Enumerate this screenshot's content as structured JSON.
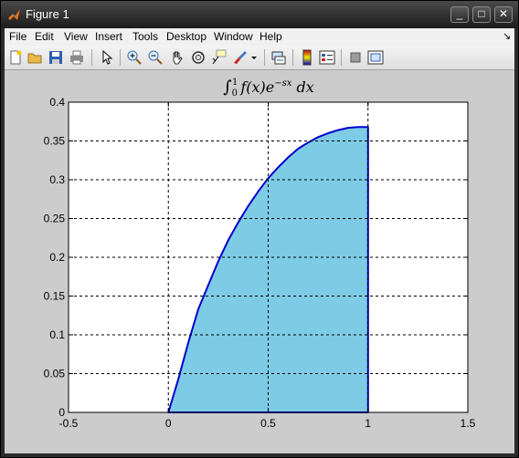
{
  "window": {
    "title": "Figure 1",
    "controls": {
      "minimize": "_",
      "maximize": "□",
      "close": "✕"
    }
  },
  "menubar": {
    "items": [
      "File",
      "Edit",
      "View",
      "Insert",
      "Tools",
      "Desktop",
      "Window",
      "Help"
    ],
    "dock_glyph": "↘"
  },
  "toolbar": {
    "buttons": [
      "new-figure",
      "open-file",
      "save",
      "print",
      "edit-plot-arrow",
      "zoom-in",
      "zoom-out",
      "pan-hand",
      "rotate-3d",
      "data-cursor",
      "brush",
      "brush-dropdown",
      "link-plot",
      "insert-colorbar",
      "insert-legend",
      "hide-plot-tools",
      "show-plot-tools"
    ]
  },
  "colors": {
    "fill": "#7ecbe6",
    "line": "#0000cc",
    "grid": "#000000",
    "background": "#cccccc"
  },
  "chart_data": {
    "type": "area",
    "title": "∫₀¹ f(x)e^(−sx) dx",
    "title_parts": {
      "integral": "∫",
      "lower": "0",
      "upper": "1",
      "fx": "f(x)e",
      "exp": "−sx",
      "dx": " dx"
    },
    "xlabel": "",
    "ylabel": "",
    "xlim": [
      -0.5,
      1.5
    ],
    "ylim": [
      0,
      0.4
    ],
    "xticks": [
      -0.5,
      0,
      0.5,
      1,
      1.5
    ],
    "xtick_labels": [
      "-0.5",
      "0",
      "0.5",
      "1",
      "1.5"
    ],
    "yticks": [
      0,
      0.05,
      0.1,
      0.15,
      0.2,
      0.25,
      0.3,
      0.35,
      0.4
    ],
    "ytick_labels": [
      "0",
      "0.05",
      "0.1",
      "0.15",
      "0.2",
      "0.25",
      "0.3",
      "0.35",
      "0.4"
    ],
    "grid": true,
    "x": [
      0,
      0.05,
      0.1,
      0.15,
      0.2,
      0.25,
      0.3,
      0.35,
      0.4,
      0.45,
      0.5,
      0.55,
      0.6,
      0.65,
      0.7,
      0.75,
      0.8,
      0.85,
      0.9,
      0.95,
      1.0,
      1.0
    ],
    "y": [
      0,
      0.043,
      0.09,
      0.133,
      0.164,
      0.195,
      0.222,
      0.245,
      0.266,
      0.285,
      0.302,
      0.316,
      0.329,
      0.34,
      0.348,
      0.355,
      0.36,
      0.364,
      0.367,
      0.368,
      0.368,
      0
    ]
  }
}
